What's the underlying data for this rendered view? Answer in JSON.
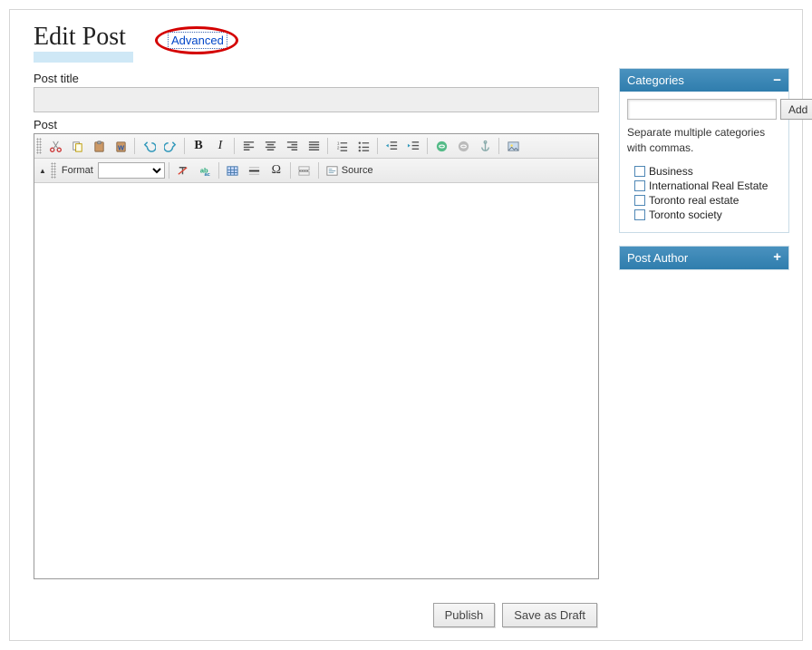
{
  "header": {
    "title": "Edit Post",
    "advanced_link": "Advanced"
  },
  "fields": {
    "title_label": "Post title",
    "title_value": "",
    "post_label": "Post"
  },
  "editor": {
    "format_label": "Format",
    "format_value": "",
    "source_label": "Source",
    "row1": [
      "cut",
      "copy",
      "paste",
      "paste-word",
      "sep",
      "undo",
      "redo",
      "sep",
      "bold",
      "italic",
      "sep",
      "align-left",
      "align-center",
      "align-right",
      "align-justify",
      "sep",
      "list-ol",
      "list-ul",
      "sep",
      "outdent",
      "indent",
      "sep",
      "link",
      "unlink",
      "anchor",
      "sep",
      "image"
    ],
    "row2": [
      "remove-format",
      "replace",
      "sep",
      "table",
      "hr",
      "special-char",
      "sep",
      "page-break",
      "sep",
      "source"
    ]
  },
  "actions": {
    "publish": "Publish",
    "draft": "Save as Draft"
  },
  "panels": {
    "categories": {
      "title": "Categories",
      "add_label": "Add",
      "hint": "Separate multiple categories with commas.",
      "input_value": "",
      "items": [
        {
          "label": "Business",
          "checked": false
        },
        {
          "label": "International Real Estate",
          "checked": false
        },
        {
          "label": "Toronto real estate",
          "checked": false
        },
        {
          "label": "Toronto society",
          "checked": false
        }
      ]
    },
    "post_author": {
      "title": "Post Author"
    }
  }
}
